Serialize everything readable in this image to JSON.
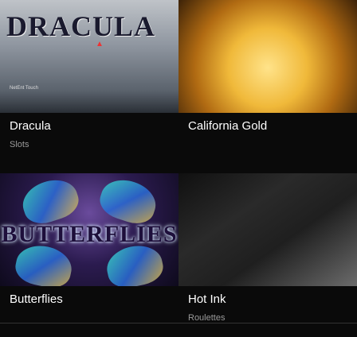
{
  "games": [
    {
      "title": "Dracula",
      "category": "Slots",
      "logo_text": "DRACULA",
      "tagline": "NetEnt Touch"
    },
    {
      "title": "California Gold",
      "category": ""
    },
    {
      "title": "Butterflies",
      "category": "",
      "logo_text": "BUTTERFLIES"
    },
    {
      "title": "Hot Ink",
      "category": "Roulettes"
    }
  ]
}
